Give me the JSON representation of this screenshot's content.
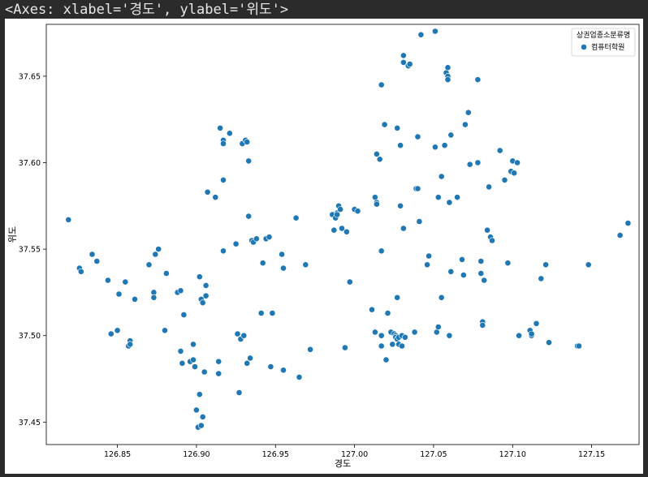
{
  "header": {
    "text": "<Axes: xlabel='경도', ylabel='위도'>"
  },
  "chart_data": {
    "type": "scatter",
    "xlabel": "경도",
    "ylabel": "위도",
    "xlim": [
      126.805,
      127.18
    ],
    "ylim": [
      37.437,
      37.68
    ],
    "xticks": [
      "126.85",
      "126.90",
      "126.95",
      "127.00",
      "127.05",
      "127.10",
      "127.15"
    ],
    "yticks": [
      "37.45",
      "37.50",
      "37.55",
      "37.60",
      "37.65"
    ],
    "grid": false,
    "legend": {
      "title": "상권업종소분류명",
      "placement": "top-right"
    },
    "marker_color": "#1f77b4",
    "series": [
      {
        "name": "컴퓨터학원",
        "points": [
          [
            126.819,
            37.567
          ],
          [
            126.826,
            37.539
          ],
          [
            126.827,
            37.537
          ],
          [
            126.834,
            37.547
          ],
          [
            126.837,
            37.543
          ],
          [
            126.844,
            37.532
          ],
          [
            126.846,
            37.501
          ],
          [
            126.85,
            37.503
          ],
          [
            126.851,
            37.524
          ],
          [
            126.855,
            37.531
          ],
          [
            126.857,
            37.494
          ],
          [
            126.858,
            37.497
          ],
          [
            126.858,
            37.495
          ],
          [
            126.861,
            37.521
          ],
          [
            126.87,
            37.541
          ],
          [
            126.873,
            37.525
          ],
          [
            126.873,
            37.522
          ],
          [
            126.874,
            37.547
          ],
          [
            126.876,
            37.55
          ],
          [
            126.88,
            37.503
          ],
          [
            126.881,
            37.536
          ],
          [
            126.888,
            37.525
          ],
          [
            126.89,
            37.526
          ],
          [
            126.89,
            37.491
          ],
          [
            126.891,
            37.484
          ],
          [
            126.892,
            37.512
          ],
          [
            126.896,
            37.485
          ],
          [
            126.898,
            37.486
          ],
          [
            126.898,
            37.495
          ],
          [
            126.899,
            37.482
          ],
          [
            126.9,
            37.457
          ],
          [
            126.901,
            37.447
          ],
          [
            126.902,
            37.466
          ],
          [
            126.903,
            37.448
          ],
          [
            126.902,
            37.534
          ],
          [
            126.903,
            37.521
          ],
          [
            126.904,
            37.519
          ],
          [
            126.904,
            37.453
          ],
          [
            126.905,
            37.479
          ],
          [
            126.906,
            37.523
          ],
          [
            126.906,
            37.529
          ],
          [
            126.907,
            37.583
          ],
          [
            126.912,
            37.58
          ],
          [
            126.914,
            37.485
          ],
          [
            126.914,
            37.478
          ],
          [
            126.915,
            37.62
          ],
          [
            126.917,
            37.613
          ],
          [
            126.917,
            37.611
          ],
          [
            126.917,
            37.59
          ],
          [
            126.917,
            37.549
          ],
          [
            126.921,
            37.617
          ],
          [
            126.925,
            37.553
          ],
          [
            126.926,
            37.501
          ],
          [
            126.927,
            37.467
          ],
          [
            126.928,
            37.498
          ],
          [
            126.929,
            37.611
          ],
          [
            126.93,
            37.5
          ],
          [
            126.931,
            37.613
          ],
          [
            126.932,
            37.612
          ],
          [
            126.932,
            37.484
          ],
          [
            126.933,
            37.601
          ],
          [
            126.933,
            37.569
          ],
          [
            126.934,
            37.487
          ],
          [
            126.935,
            37.555
          ],
          [
            126.936,
            37.554
          ],
          [
            126.938,
            37.556
          ],
          [
            126.941,
            37.513
          ],
          [
            126.942,
            37.542
          ],
          [
            126.944,
            37.556
          ],
          [
            126.946,
            37.557
          ],
          [
            126.947,
            37.482
          ],
          [
            126.948,
            37.513
          ],
          [
            126.954,
            37.547
          ],
          [
            126.955,
            37.539
          ],
          [
            126.955,
            37.48
          ],
          [
            126.963,
            37.568
          ],
          [
            126.965,
            37.476
          ],
          [
            126.969,
            37.541
          ],
          [
            126.972,
            37.492
          ],
          [
            126.986,
            37.57
          ],
          [
            126.987,
            37.561
          ],
          [
            126.988,
            37.568
          ],
          [
            126.989,
            37.571
          ],
          [
            126.989,
            37.57
          ],
          [
            126.99,
            37.575
          ],
          [
            126.991,
            37.573
          ],
          [
            126.992,
            37.562
          ],
          [
            126.994,
            37.493
          ],
          [
            126.995,
            37.56
          ],
          [
            126.997,
            37.531
          ],
          [
            127.0,
            37.573
          ],
          [
            127.002,
            37.572
          ],
          [
            127.011,
            37.515
          ],
          [
            127.013,
            37.502
          ],
          [
            127.013,
            37.58
          ],
          [
            127.014,
            37.577
          ],
          [
            127.014,
            37.576
          ],
          [
            127.014,
            37.605
          ],
          [
            127.016,
            37.602
          ],
          [
            127.017,
            37.549
          ],
          [
            127.017,
            37.645
          ],
          [
            127.017,
            37.5
          ],
          [
            127.017,
            37.494
          ],
          [
            127.019,
            37.622
          ],
          [
            127.02,
            37.486
          ],
          [
            127.021,
            37.513
          ],
          [
            127.023,
            37.502
          ],
          [
            127.024,
            37.495
          ],
          [
            127.025,
            37.501
          ],
          [
            127.026,
            37.5
          ],
          [
            127.026,
            37.499
          ],
          [
            127.027,
            37.498
          ],
          [
            127.027,
            37.62
          ],
          [
            127.027,
            37.522
          ],
          [
            127.028,
            37.499
          ],
          [
            127.028,
            37.495
          ],
          [
            127.029,
            37.61
          ],
          [
            127.029,
            37.575
          ],
          [
            127.03,
            37.5
          ],
          [
            127.03,
            37.494
          ],
          [
            127.031,
            37.562
          ],
          [
            127.031,
            37.662
          ],
          [
            127.031,
            37.658
          ],
          [
            127.032,
            37.499
          ],
          [
            127.034,
            37.656
          ],
          [
            127.035,
            37.657
          ],
          [
            127.038,
            37.502
          ],
          [
            127.039,
            37.585
          ],
          [
            127.04,
            37.585
          ],
          [
            127.04,
            37.615
          ],
          [
            127.041,
            37.566
          ],
          [
            127.042,
            37.674
          ],
          [
            127.046,
            37.541
          ],
          [
            127.047,
            37.546
          ],
          [
            127.051,
            37.676
          ],
          [
            127.051,
            37.609
          ],
          [
            127.052,
            37.502
          ],
          [
            127.053,
            37.505
          ],
          [
            127.053,
            37.58
          ],
          [
            127.055,
            37.522
          ],
          [
            127.055,
            37.592
          ],
          [
            127.057,
            37.61
          ],
          [
            127.058,
            37.652
          ],
          [
            127.059,
            37.65
          ],
          [
            127.059,
            37.655
          ],
          [
            127.059,
            37.648
          ],
          [
            127.06,
            37.5
          ],
          [
            127.06,
            37.577
          ],
          [
            127.061,
            37.616
          ],
          [
            127.061,
            37.537
          ],
          [
            127.065,
            37.58
          ],
          [
            127.068,
            37.544
          ],
          [
            127.069,
            37.535
          ],
          [
            127.07,
            37.622
          ],
          [
            127.072,
            37.629
          ],
          [
            127.073,
            37.599
          ],
          [
            127.078,
            37.648
          ],
          [
            127.078,
            37.6
          ],
          [
            127.08,
            37.536
          ],
          [
            127.08,
            37.543
          ],
          [
            127.081,
            37.508
          ],
          [
            127.081,
            37.506
          ],
          [
            127.082,
            37.532
          ],
          [
            127.084,
            37.561
          ],
          [
            127.085,
            37.586
          ],
          [
            127.086,
            37.557
          ],
          [
            127.087,
            37.555
          ],
          [
            127.092,
            37.607
          ],
          [
            127.095,
            37.59
          ],
          [
            127.097,
            37.542
          ],
          [
            127.099,
            37.595
          ],
          [
            127.1,
            37.601
          ],
          [
            127.101,
            37.594
          ],
          [
            127.103,
            37.6
          ],
          [
            127.104,
            37.5
          ],
          [
            127.111,
            37.503
          ],
          [
            127.112,
            37.5
          ],
          [
            127.112,
            37.501
          ],
          [
            127.115,
            37.507
          ],
          [
            127.118,
            37.533
          ],
          [
            127.121,
            37.541
          ],
          [
            127.123,
            37.496
          ],
          [
            127.141,
            37.494
          ],
          [
            127.142,
            37.494
          ],
          [
            127.148,
            37.541
          ],
          [
            127.168,
            37.558
          ],
          [
            127.173,
            37.565
          ]
        ]
      }
    ]
  }
}
